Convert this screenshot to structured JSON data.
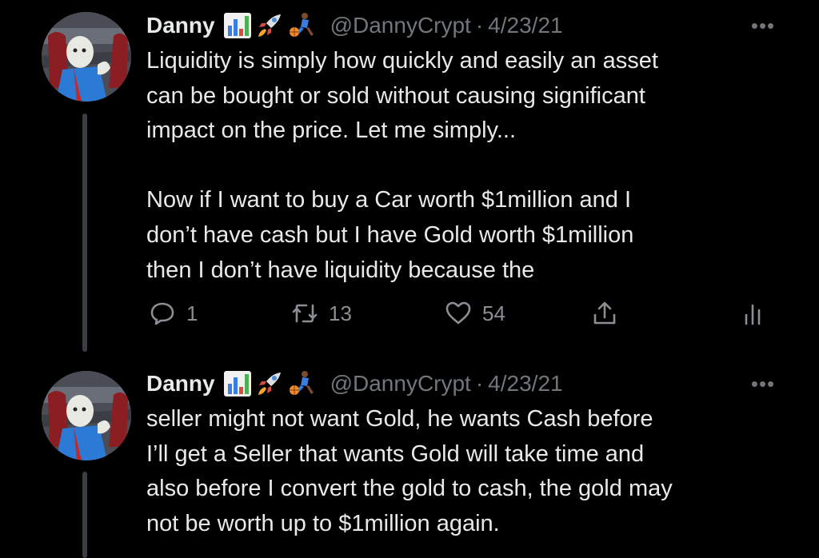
{
  "theme": {
    "background": "#000000",
    "text": "#e7e9ea",
    "muted": "#71767b"
  },
  "tweets": [
    {
      "author_name": "Danny",
      "emojis": [
        "bar-chart-emoji",
        "rocket-emoji",
        "basketball-player-emoji"
      ],
      "handle": "@DannyCrypt",
      "separator": "·",
      "date": "4/23/21",
      "more": "•••",
      "lines": [
        "Liquidity is simply how quickly and easily an asset",
        "can be bought or sold without causing significant",
        "impact on the price. Let me simply...",
        "",
        "Now if I want to buy a Car worth $1million and I",
        "don’t have cash but I have Gold worth $1million",
        "then I don’t have liquidity because the"
      ],
      "replies": "1",
      "retweets": "13",
      "likes": "54"
    },
    {
      "author_name": "Danny",
      "emojis": [
        "bar-chart-emoji",
        "rocket-emoji",
        "basketball-player-emoji"
      ],
      "handle": "@DannyCrypt",
      "separator": "·",
      "date": "4/23/21",
      "more": "•••",
      "lines": [
        "seller might not want Gold, he wants Cash before",
        "I’ll get a Seller that wants Gold will take time and",
        "also before I convert the gold to cash, the gold may",
        "not be worth up to $1million again."
      ]
    }
  ]
}
